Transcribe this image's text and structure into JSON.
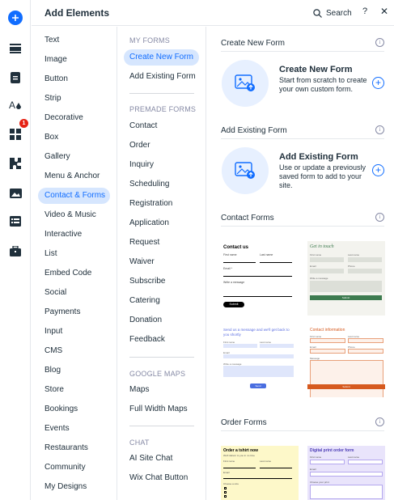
{
  "header": {
    "title": "Add Elements",
    "search_label": "Search",
    "help_label": "?",
    "close_label": "✕"
  },
  "rail": {
    "badge_count": "1",
    "icons": [
      "add-icon",
      "menus-icon",
      "pages-icon",
      "theme-icon",
      "apps-icon",
      "plugins-icon",
      "media-icon",
      "cms-icon",
      "business-icon"
    ]
  },
  "categories": [
    "Text",
    "Image",
    "Button",
    "Strip",
    "Decorative",
    "Box",
    "Gallery",
    "Menu & Anchor",
    "Contact & Forms",
    "Video & Music",
    "Interactive",
    "List",
    "Embed Code",
    "Social",
    "Payments",
    "Input",
    "CMS",
    "Blog",
    "Store",
    "Bookings",
    "Events",
    "Restaurants",
    "Community",
    "My Designs"
  ],
  "active_category": "Contact & Forms",
  "subcategories": {
    "my_forms_header": "MY FORMS",
    "my_forms": [
      "Create New Form",
      "Add Existing Form"
    ],
    "premade_header": "PREMADE FORMS",
    "premade": [
      "Contact",
      "Order",
      "Inquiry",
      "Scheduling",
      "Registration",
      "Application",
      "Request",
      "Waiver",
      "Subscribe",
      "Catering",
      "Donation",
      "Feedback"
    ],
    "google_header": "GOOGLE MAPS",
    "google": [
      "Maps",
      "Full Width Maps"
    ],
    "chat_header": "CHAT",
    "chat": [
      "AI Site Chat",
      "Wix Chat Button"
    ]
  },
  "content": {
    "create_section": "Create New Form",
    "create_title": "Create New Form",
    "create_desc": "Start from scratch to create your own custom form.",
    "existing_section": "Add Existing Form",
    "existing_title": "Add Existing Form",
    "existing_desc": "Use or update a previously saved form to add to your site.",
    "contact_section": "Contact Forms",
    "order_section": "Order Forms",
    "info_glyph": "i",
    "plus_glyph": "+"
  },
  "thumbs": {
    "contact1": {
      "title": "Contact us",
      "first": "First name",
      "last": "Last name",
      "email": "Email *",
      "message": "Write a message",
      "button": "Submit"
    },
    "contact2": {
      "title": "Get in touch",
      "first": "First name",
      "last": "Last name",
      "email": "Email",
      "phone": "Phone",
      "message": "Write a message",
      "button": "Submit"
    },
    "contact3": {
      "title": "Send us a message and we'll get back to you shortly",
      "first": "First name",
      "last": "Last name",
      "email": "Email",
      "message": "Write a message",
      "button": "Send"
    },
    "contact4": {
      "title": "Contact information",
      "first": "First name",
      "last": "Last name",
      "email": "Email",
      "phone": "Phone",
      "message": "Message",
      "button": "Submit"
    },
    "order1": {
      "title": "Order a tshirt now",
      "subtitle": "We'll deliver to you in no time",
      "first": "First name",
      "last": "Last name",
      "email": "Email",
      "size": "Choose a size"
    },
    "order2": {
      "title": "Digital print order form",
      "first": "First name",
      "last": "Last name",
      "email": "Email",
      "choose": "Choose your print"
    }
  },
  "colors": {
    "accent": "#116dff",
    "accent_bg": "#d6e6fe",
    "badge": "#e62214",
    "green": "#3d7b4f",
    "orange": "#d65a1f"
  }
}
